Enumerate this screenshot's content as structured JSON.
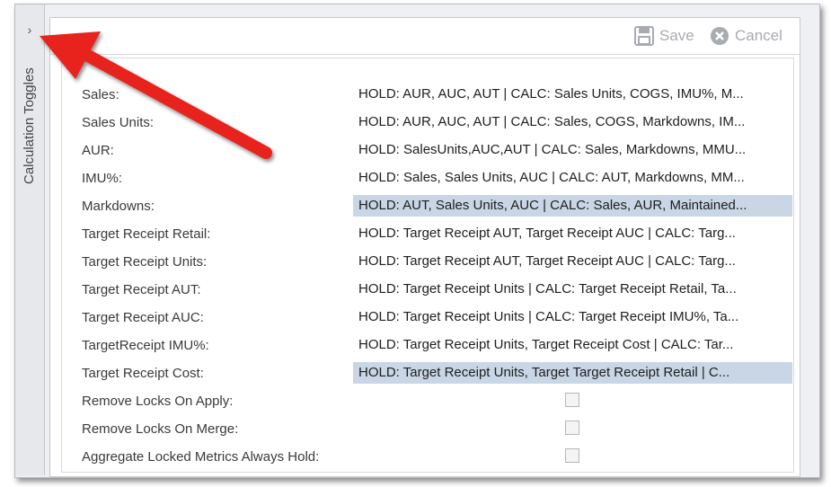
{
  "side_panel": {
    "title": "Calculation Toggles",
    "chevron": "›"
  },
  "toolbar": {
    "save_label": "Save",
    "cancel_label": "Cancel"
  },
  "rows": [
    {
      "label": "Sales:",
      "value": "HOLD: AUR, AUC, AUT | CALC: Sales Units, COGS, IMU%, M..."
    },
    {
      "label": "Sales Units:",
      "value": "HOLD: AUR, AUC, AUT | CALC: Sales, COGS, Markdowns, IM..."
    },
    {
      "label": "AUR:",
      "value": "HOLD: SalesUnits,AUC,AUT | CALC: Sales, Markdowns, MMU..."
    },
    {
      "label": "IMU%:",
      "value": "HOLD: Sales, Sales Units, AUC | CALC: AUT, Markdowns, MM..."
    },
    {
      "label": "Markdowns:",
      "value": "HOLD: AUT, Sales Units, AUC | CALC: Sales, AUR, Maintained...",
      "selected": true
    },
    {
      "label": "Target Receipt Retail:",
      "value": "HOLD: Target Receipt AUT, Target Receipt AUC | CALC: Targ..."
    },
    {
      "label": "Target Receipt Units:",
      "value": "HOLD: Target Receipt AUT, Target Receipt AUC | CALC: Targ..."
    },
    {
      "label": "Target Receipt AUT:",
      "value": "HOLD: Target Receipt Units | CALC: Target Receipt Retail, Ta..."
    },
    {
      "label": "Target Receipt AUC:",
      "value": "HOLD: Target Receipt Units | CALC: Target Receipt IMU%, Ta..."
    },
    {
      "label": "TargetReceipt IMU%:",
      "value": "HOLD: Target Receipt Units, Target Receipt Cost | CALC: Tar..."
    },
    {
      "label": "Target Receipt Cost:",
      "value": "HOLD: Target Receipt Units, Target Target Receipt Retail | C...",
      "selected": true
    }
  ],
  "checkbox_rows": [
    {
      "label": "Remove Locks On Apply:",
      "checked": false
    },
    {
      "label": "Remove Locks On Merge:",
      "checked": false
    },
    {
      "label": "Aggregate Locked Metrics Always Hold:",
      "checked": false
    }
  ],
  "colors": {
    "arrow": "#e8201a",
    "selection": "#c8d6e6"
  }
}
